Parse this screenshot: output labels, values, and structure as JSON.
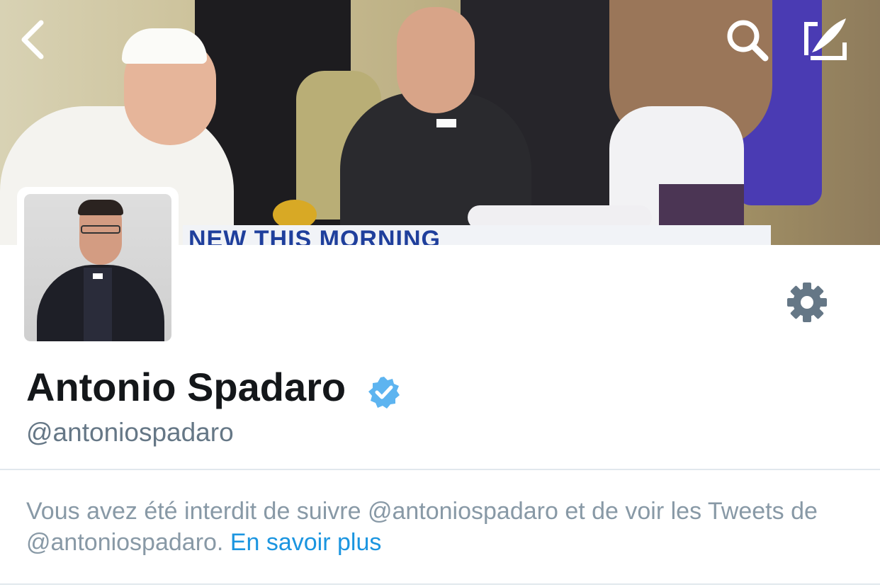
{
  "banner": {
    "caption": "NEW THIS MORNING"
  },
  "toolbar": {
    "back_icon": "chevron-left-icon",
    "search_icon": "search-icon",
    "compose_icon": "compose-tweet-icon"
  },
  "profile": {
    "name": "Antonio Spadaro",
    "handle": "@antoniospadaro",
    "verified": true,
    "verified_color": "#5db4f0",
    "settings_icon": "gear-icon"
  },
  "notice": {
    "text": "Vous avez été interdit de suivre @antoniospadaro et de voir les Tweets de @antoniospadaro.",
    "link": "En savoir plus",
    "link_color": "#1b95e0"
  }
}
